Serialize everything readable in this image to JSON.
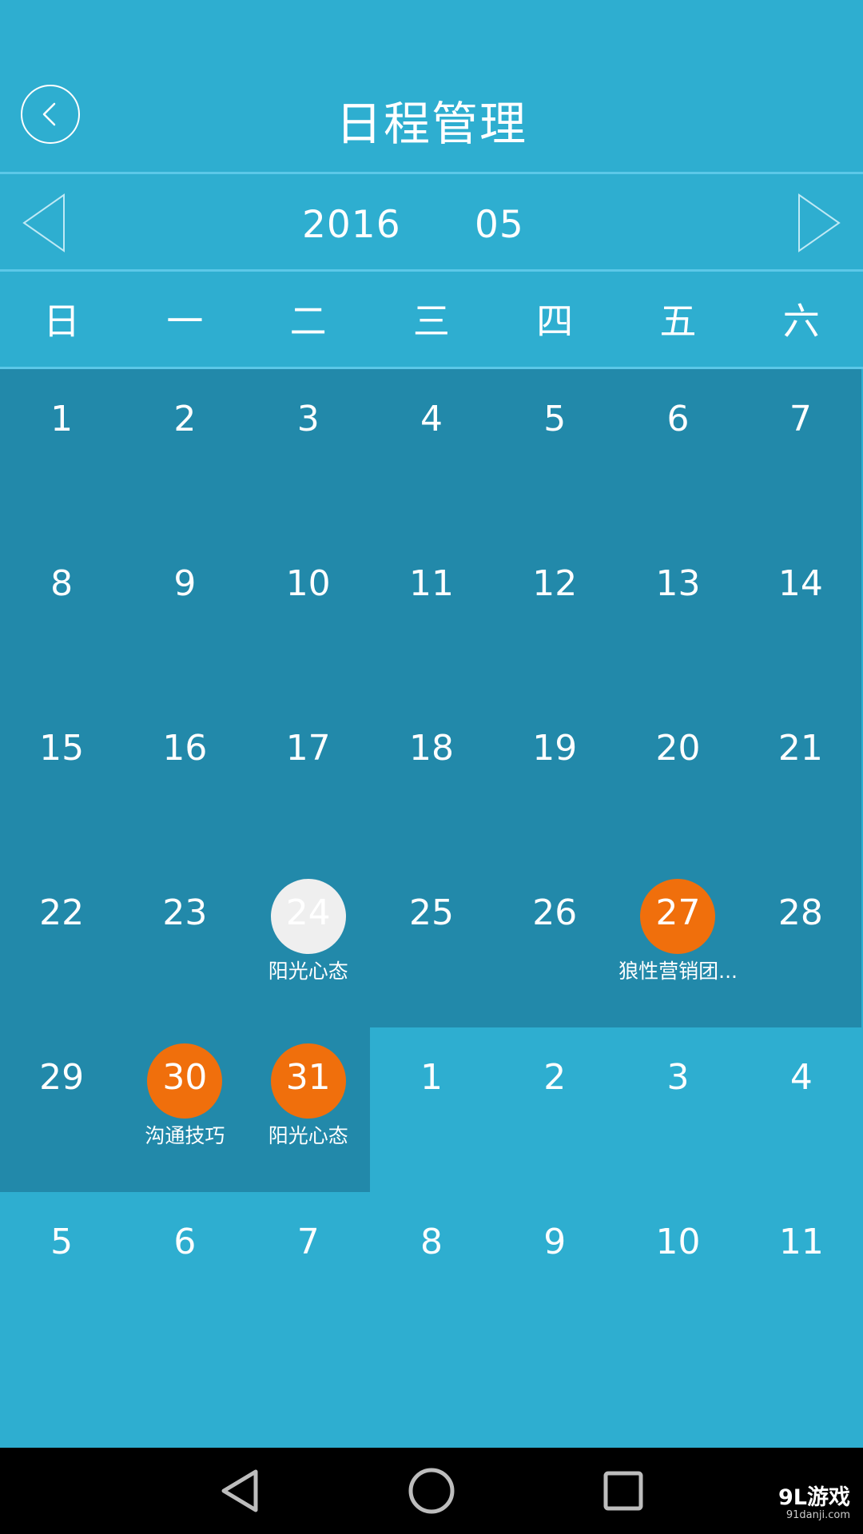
{
  "header": {
    "title": "日程管理",
    "back_icon": "chevron-left-circle-icon"
  },
  "month_nav": {
    "year": "2016",
    "month": "05",
    "prev_icon": "triangle-left-outline-icon",
    "next_icon": "triangle-right-outline-icon"
  },
  "weekdays": [
    "日",
    "一",
    "二",
    "三",
    "四",
    "五",
    "六"
  ],
  "calendar": {
    "weeks": [
      [
        {
          "day": "1",
          "current": true
        },
        {
          "day": "2",
          "current": true
        },
        {
          "day": "3",
          "current": true
        },
        {
          "day": "4",
          "current": true
        },
        {
          "day": "5",
          "current": true
        },
        {
          "day": "6",
          "current": true
        },
        {
          "day": "7",
          "current": true
        }
      ],
      [
        {
          "day": "8",
          "current": true
        },
        {
          "day": "9",
          "current": true
        },
        {
          "day": "10",
          "current": true
        },
        {
          "day": "11",
          "current": true
        },
        {
          "day": "12",
          "current": true
        },
        {
          "day": "13",
          "current": true
        },
        {
          "day": "14",
          "current": true
        }
      ],
      [
        {
          "day": "15",
          "current": true
        },
        {
          "day": "16",
          "current": true
        },
        {
          "day": "17",
          "current": true
        },
        {
          "day": "18",
          "current": true
        },
        {
          "day": "19",
          "current": true
        },
        {
          "day": "20",
          "current": true
        },
        {
          "day": "21",
          "current": true
        }
      ],
      [
        {
          "day": "22",
          "current": true
        },
        {
          "day": "23",
          "current": true
        },
        {
          "day": "24",
          "current": true,
          "marker": "gray",
          "event": "阳光心态"
        },
        {
          "day": "25",
          "current": true
        },
        {
          "day": "26",
          "current": true
        },
        {
          "day": "27",
          "current": true,
          "marker": "orange",
          "event": "狼性营销团..."
        },
        {
          "day": "28",
          "current": true
        }
      ],
      [
        {
          "day": "29",
          "current": true
        },
        {
          "day": "30",
          "current": true,
          "marker": "orange",
          "event": "沟通技巧"
        },
        {
          "day": "31",
          "current": true,
          "marker": "orange",
          "event": "阳光心态"
        },
        {
          "day": "1",
          "current": false
        },
        {
          "day": "2",
          "current": false
        },
        {
          "day": "3",
          "current": false
        },
        {
          "day": "4",
          "current": false
        }
      ],
      [
        {
          "day": "5",
          "current": false
        },
        {
          "day": "6",
          "current": false
        },
        {
          "day": "7",
          "current": false
        },
        {
          "day": "8",
          "current": false
        },
        {
          "day": "9",
          "current": false
        },
        {
          "day": "10",
          "current": false
        },
        {
          "day": "11",
          "current": false
        }
      ]
    ]
  },
  "colors": {
    "background": "#2eaed0",
    "current_month_cell": "#2289aa",
    "event_marker": "#f06f0c",
    "selected_marker": "#efefef",
    "navbar": "#000000"
  },
  "system_nav": {
    "back_icon": "nav-back-icon",
    "home_icon": "nav-home-icon",
    "recent_icon": "nav-recent-apps-icon"
  },
  "watermark": {
    "brand": "9L游戏",
    "url": "91danji.com"
  }
}
